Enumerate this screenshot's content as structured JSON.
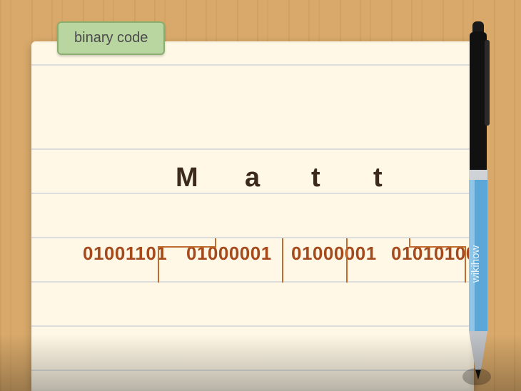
{
  "tag_label": "binary code",
  "word": {
    "letters": [
      "M",
      "a",
      "t",
      "t"
    ],
    "binary": [
      "01001101",
      "01000001",
      "01000001",
      "01010100"
    ]
  },
  "pen_brand": "wikihow",
  "colors": {
    "paper": "#fff8e6",
    "tag_bg": "#b9d6a0",
    "tag_border": "#8aae6e",
    "ink": "#a54a1c",
    "letter": "#3c2a1e",
    "wood": "#d8a96a",
    "pen_blue": "#5aa7d8"
  }
}
